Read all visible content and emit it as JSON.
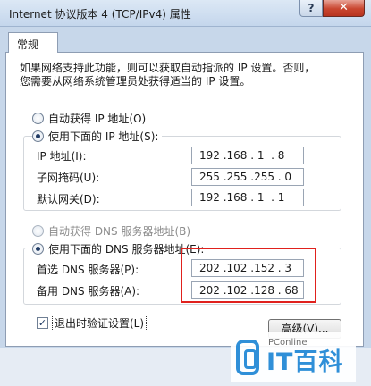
{
  "window": {
    "title": "Internet 协议版本 4 (TCP/IPv4) 属性",
    "help_label": "?",
    "close_label": "✕"
  },
  "tabs": [
    {
      "label": "常规"
    }
  ],
  "intro": {
    "line1": "如果网络支持此功能，则可以获取自动指派的 IP 设置。否则，",
    "line2": "您需要从网络系统管理员处获得适当的 IP 设置。"
  },
  "ip_section": {
    "auto_label": "自动获得 IP 地址(O)",
    "manual_label": "使用下面的 IP 地址(S):",
    "selected": "manual",
    "fields": [
      {
        "label": "IP 地址(I):",
        "value": "192 .168 . 1  . 8"
      },
      {
        "label": "子网掩码(U):",
        "value": "255 .255 .255 . 0"
      },
      {
        "label": "默认网关(D):",
        "value": "192 .168 . 1  . 1"
      }
    ]
  },
  "dns_section": {
    "auto_label": "自动获得 DNS 服务器地址(B)",
    "manual_label": "使用下面的 DNS 服务器地址(E):",
    "selected": "manual",
    "fields": [
      {
        "label": "首选 DNS 服务器(P):",
        "value": "202 .102 .152 . 3"
      },
      {
        "label": "备用 DNS 服务器(A):",
        "value": "202 .102 .128 . 68"
      }
    ],
    "highlight_color": "#e0211d"
  },
  "validate_checkbox": {
    "label": "退出时验证设置(L)",
    "checked": true
  },
  "advanced_button": {
    "label": "高级(V)..."
  },
  "watermark": {
    "brand": "PConline",
    "text": "IT百科",
    "color": "#2f8fd8"
  }
}
